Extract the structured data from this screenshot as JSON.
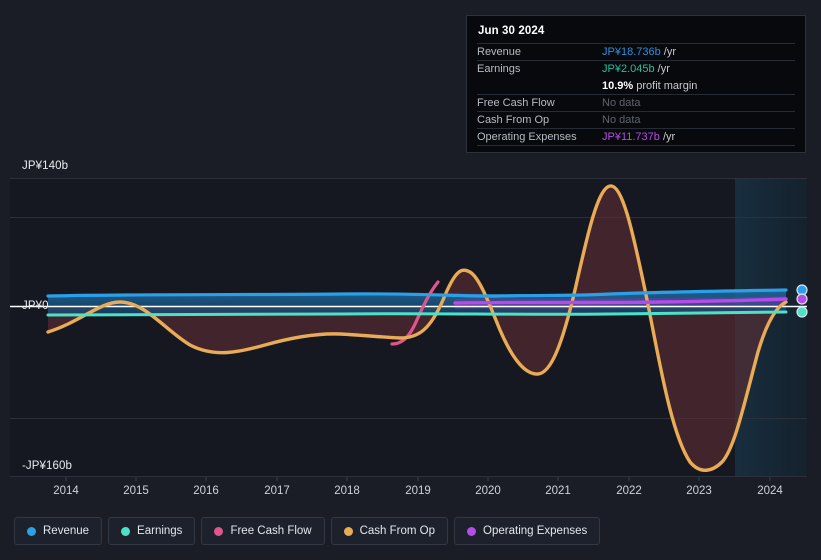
{
  "chart_data": {
    "type": "line",
    "title": "",
    "xlabel": "",
    "ylabel": "",
    "currency": "JP¥",
    "ylim": [
      -160,
      140
    ],
    "y_ticks": [
      "JP¥140b",
      "JP¥0",
      "-JP¥160b"
    ],
    "y_tick_values": [
      140,
      0,
      -160
    ],
    "grid": true,
    "legend_position": "bottom",
    "x": [
      2014,
      2015,
      2016,
      2017,
      2018,
      2019,
      2020,
      2021,
      2022,
      2023,
      2024
    ],
    "categories": [
      "2014",
      "2015",
      "2016",
      "2017",
      "2018",
      "2019",
      "2020",
      "2021",
      "2022",
      "2023",
      "2024"
    ],
    "forecast_start": 2023.6,
    "series": [
      {
        "name": "Revenue",
        "color": "#2b9fe8",
        "values": [
          14.8,
          15.2,
          15.4,
          15.2,
          15.4,
          15.6,
          16.0,
          15.4,
          16.4,
          17.6,
          18.736
        ]
      },
      {
        "name": "Earnings",
        "color": "#4fe0c8",
        "values": [
          1.2,
          1.4,
          1.5,
          1.4,
          1.5,
          1.7,
          1.8,
          1.5,
          1.9,
          2.0,
          2.045
        ]
      },
      {
        "name": "Free Cash Flow",
        "color": "#e0568c",
        "values": [
          null,
          null,
          null,
          null,
          null,
          -34,
          12,
          null,
          null,
          null,
          null
        ]
      },
      {
        "name": "Cash From Op",
        "color": "#e9ab55",
        "values": [
          -22,
          -6,
          -32,
          -44,
          -30,
          -20,
          48,
          -78,
          135,
          -160,
          10
        ]
      },
      {
        "name": "Operating Expenses",
        "color": "#b44ce8",
        "values": [
          null,
          null,
          null,
          null,
          null,
          11.0,
          11.1,
          10.8,
          11.2,
          11.5,
          11.737
        ]
      }
    ]
  },
  "tooltip": {
    "date": "Jun 30 2024",
    "rows": [
      {
        "label": "Revenue",
        "value": "JP¥18.736b",
        "unit": " /yr",
        "color": "#2b8fe0",
        "no_data": false
      },
      {
        "label": "Earnings",
        "value": "JP¥2.045b",
        "unit": " /yr",
        "color": "#2bbfa0",
        "no_data": false
      },
      {
        "label": "",
        "value": "10.9%",
        "unit": " profit margin",
        "color": "#ffffff",
        "no_data": false,
        "is_margin": true
      },
      {
        "label": "Free Cash Flow",
        "value": "No data",
        "unit": "",
        "color": "#5e646e",
        "no_data": true
      },
      {
        "label": "Cash From Op",
        "value": "No data",
        "unit": "",
        "color": "#5e646e",
        "no_data": true
      },
      {
        "label": "Operating Expenses",
        "value": "JP¥11.737b",
        "unit": " /yr",
        "color": "#b44ce8",
        "no_data": false
      }
    ]
  },
  "legend": {
    "items": [
      {
        "label": "Revenue",
        "color": "#2b9fe8"
      },
      {
        "label": "Earnings",
        "color": "#4fe0c8"
      },
      {
        "label": "Free Cash Flow",
        "color": "#e0568c"
      },
      {
        "label": "Cash From Op",
        "color": "#e9ab55"
      },
      {
        "label": "Operating Expenses",
        "color": "#b44ce8"
      }
    ]
  },
  "axis": {
    "y_top": "JP¥140b",
    "y_zero": "JP¥0",
    "y_bottom": "-JP¥160b",
    "x_labels": [
      "2014",
      "2015",
      "2016",
      "2017",
      "2018",
      "2019",
      "2020",
      "2021",
      "2022",
      "2023",
      "2024"
    ]
  }
}
